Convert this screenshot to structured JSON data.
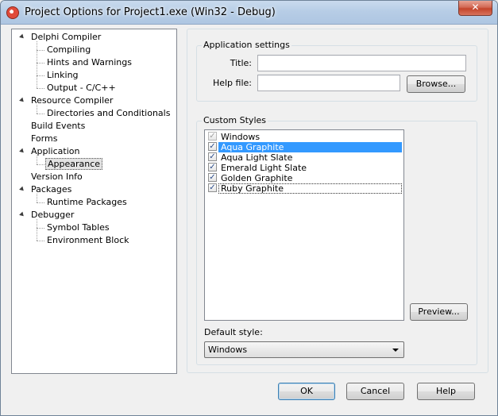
{
  "window": {
    "title": "Project Options for Project1.exe  (Win32 - Debug)",
    "close_label": "✕"
  },
  "tree": {
    "items": [
      {
        "label": "Delphi Compiler",
        "level": 0,
        "expandable": true
      },
      {
        "label": "Compiling",
        "level": 1
      },
      {
        "label": "Hints and Warnings",
        "level": 1
      },
      {
        "label": "Linking",
        "level": 1
      },
      {
        "label": "Output - C/C++",
        "level": 1
      },
      {
        "label": "Resource Compiler",
        "level": 0,
        "expandable": true
      },
      {
        "label": "Directories and Conditionals",
        "level": 1
      },
      {
        "label": "Build Events",
        "level": 0
      },
      {
        "label": "Forms",
        "level": 0
      },
      {
        "label": "Application",
        "level": 0,
        "expandable": true
      },
      {
        "label": "Appearance",
        "level": 1,
        "selected": true
      },
      {
        "label": "Version Info",
        "level": 0
      },
      {
        "label": "Packages",
        "level": 0,
        "expandable": true
      },
      {
        "label": "Runtime Packages",
        "level": 1
      },
      {
        "label": "Debugger",
        "level": 0,
        "expandable": true
      },
      {
        "label": "Symbol Tables",
        "level": 1
      },
      {
        "label": "Environment Block",
        "level": 1
      }
    ]
  },
  "app_settings": {
    "caption": "Application settings",
    "title_label": "Title:",
    "title_value": "",
    "helpfile_label": "Help file:",
    "helpfile_value": "",
    "browse_label": "Browse..."
  },
  "custom_styles": {
    "caption": "Custom Styles",
    "styles": [
      {
        "label": "Windows",
        "checked": true,
        "disabled": true
      },
      {
        "label": "Aqua Graphite",
        "checked": true,
        "selected": true
      },
      {
        "label": "Aqua Light Slate",
        "checked": true
      },
      {
        "label": "Emerald Light Slate",
        "checked": true
      },
      {
        "label": "Golden Graphite",
        "checked": true
      },
      {
        "label": "Ruby Graphite",
        "checked": true,
        "focused": true
      }
    ],
    "preview_label": "Preview...",
    "default_style_label": "Default style:",
    "default_style_value": "Windows"
  },
  "footer": {
    "ok_label": "OK",
    "cancel_label": "Cancel",
    "help_label": "Help"
  },
  "colors": {
    "selection": "#3399ff",
    "titlebar": "#b7cde6"
  }
}
